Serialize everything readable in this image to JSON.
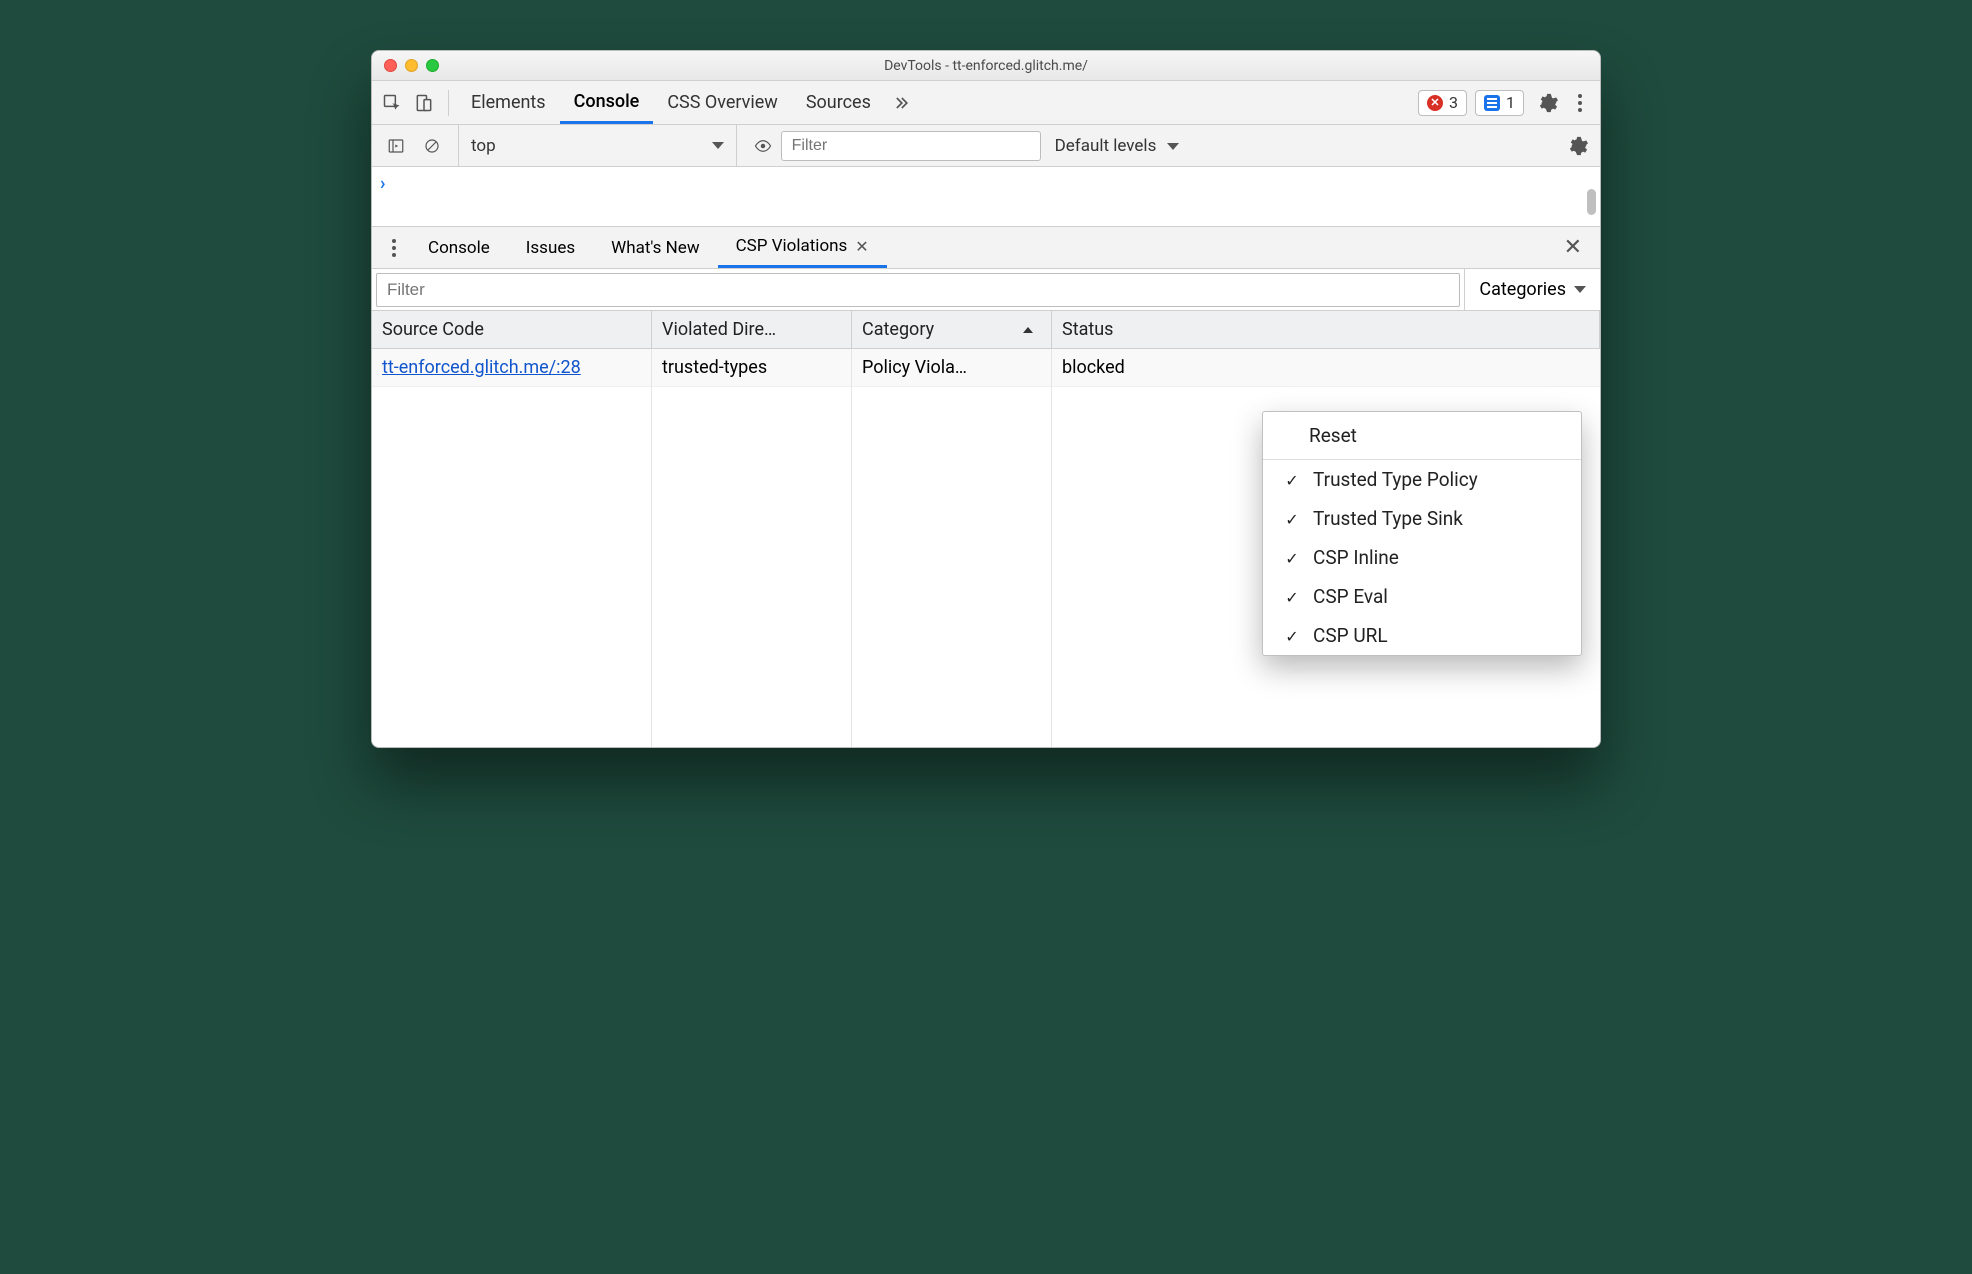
{
  "window": {
    "title": "DevTools - tt-enforced.glitch.me/"
  },
  "main_tabs": {
    "elements": "Elements",
    "console": "Console",
    "css_overview": "CSS Overview",
    "sources": "Sources"
  },
  "counts": {
    "errors": "3",
    "issues": "1"
  },
  "console_toolbar": {
    "context": "top",
    "filter_placeholder": "Filter",
    "levels": "Default levels"
  },
  "drawer": {
    "console": "Console",
    "issues": "Issues",
    "whats_new": "What's New",
    "csp": "CSP Violations"
  },
  "csp_panel": {
    "filter_placeholder": "Filter",
    "categories_label": "Categories",
    "columns": {
      "source": "Source Code",
      "directive": "Violated Dire…",
      "category": "Category",
      "status": "Status"
    },
    "rows": [
      {
        "source": "tt-enforced.glitch.me/:28",
        "directive": "trusted-types",
        "category": "Policy Viola…",
        "status": "blocked"
      }
    ]
  },
  "categories_menu": {
    "reset": "Reset",
    "items": [
      "Trusted Type Policy",
      "Trusted Type Sink",
      "CSP Inline",
      "CSP Eval",
      "CSP URL"
    ]
  }
}
